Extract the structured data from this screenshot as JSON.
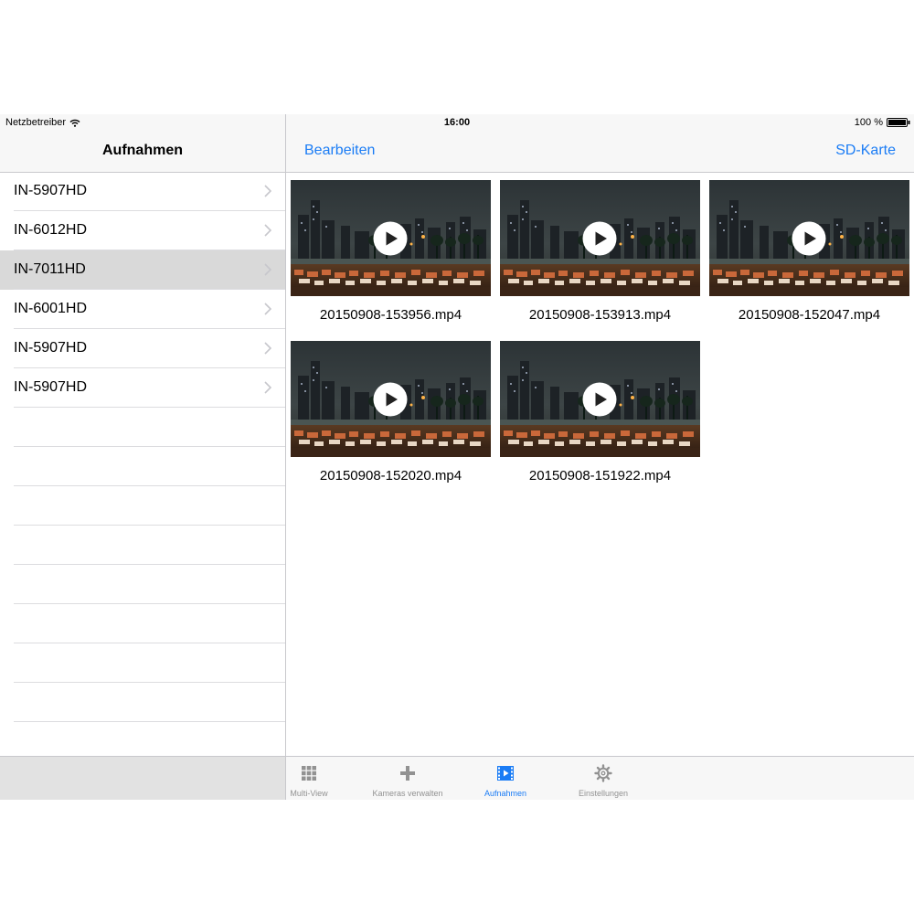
{
  "status": {
    "carrier": "Netzbetreiber",
    "time": "16:00",
    "battery": "100 %"
  },
  "sidebar": {
    "title": "Aufnahmen",
    "items": [
      {
        "label": "IN-5907HD"
      },
      {
        "label": "IN-6012HD"
      },
      {
        "label": "IN-7011HD",
        "selected": true
      },
      {
        "label": "IN-6001HD"
      },
      {
        "label": "IN-5907HD"
      },
      {
        "label": "IN-5907HD"
      }
    ]
  },
  "header": {
    "edit_label": "Bearbeiten",
    "sd_label": "SD-Karte"
  },
  "recordings": [
    {
      "filename": "20150908-153956.mp4"
    },
    {
      "filename": "20150908-153913.mp4"
    },
    {
      "filename": "20150908-152047.mp4"
    },
    {
      "filename": "20150908-152020.mp4"
    },
    {
      "filename": "20150908-151922.mp4"
    }
  ],
  "tabs": [
    {
      "label": "Multi-View",
      "icon": "grid-icon"
    },
    {
      "label": "Kameras verwalten",
      "icon": "plus-icon"
    },
    {
      "label": "Aufnahmen",
      "icon": "film-icon",
      "active": true
    },
    {
      "label": "Einstellungen",
      "icon": "gear-icon"
    }
  ],
  "colors": {
    "accent": "#1a7cf5",
    "selected_row": "#d9d9d9",
    "inactive_tab": "#929292"
  }
}
